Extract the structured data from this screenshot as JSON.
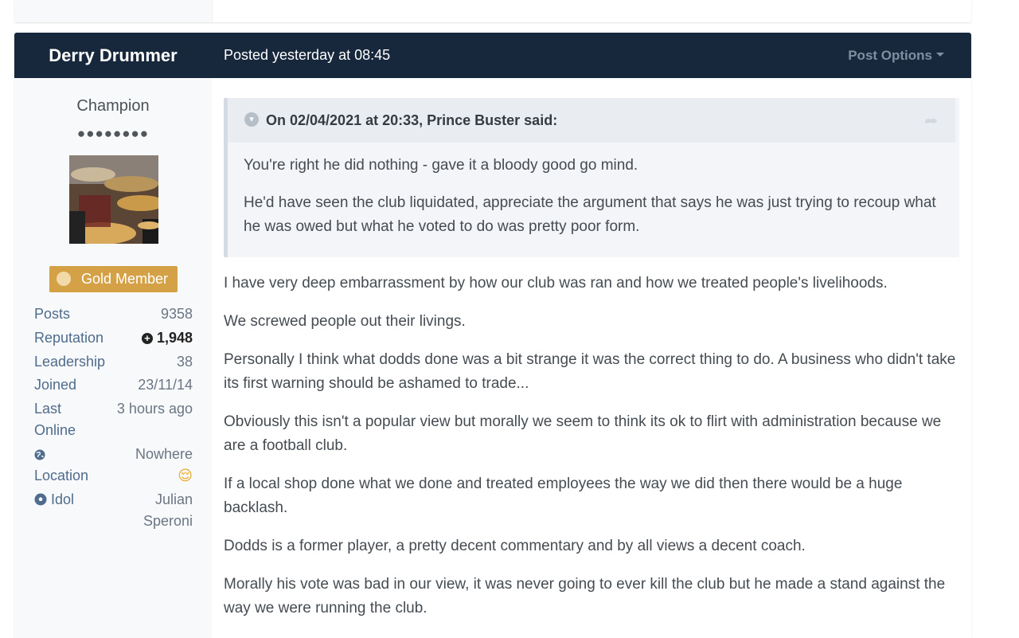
{
  "post": {
    "author": "Derry Drummer",
    "date": "Posted yesterday at 08:45",
    "options_label": "Post Options"
  },
  "author_panel": {
    "rank_title": "Champion",
    "rank_pips": "●●●●●●●●",
    "group_badge": "Gold Member",
    "stats": {
      "posts_label": "Posts",
      "posts_value": "9358",
      "reputation_label": "Reputation",
      "reputation_value": "1,948",
      "leadership_label": "Leadership",
      "leadership_value": "38",
      "joined_label": "Joined",
      "joined_value": "23/11/14",
      "last_online_label_1": "Last",
      "last_online_label_2": "Online",
      "last_online_value": "3 hours ago",
      "location_label": "Location",
      "location_value": "Nowhere",
      "location_emoji": "😌",
      "idol_label": "Idol",
      "idol_value_1": "Julian",
      "idol_value_2": "Speroni"
    }
  },
  "quote": {
    "citation": "On 02/04/2021 at 20:33, Prince Buster said:",
    "paragraphs": [
      "You're right he did nothing - gave it a bloody good go mind.",
      "He'd have seen the club liquidated, appreciate the argument that says he was just trying to recoup what he was owed but what he voted to do was pretty poor form."
    ]
  },
  "body": {
    "paragraphs": [
      "I have very deep embarrassment by how our club was ran and how we treated people's livelihoods.",
      "We screwed people out their livings.",
      "Personally I think what dodds done was a bit strange it was the correct thing to do. A business who didn't take its first warning should be ashamed to trade...",
      "Obviously this isn't a popular view but morally we seem to think its ok to flirt with administration because we are a football club.",
      "If a local shop done what we done and treated employees the way we did then there would be a huge backlash.",
      "Dodds is a former player, a pretty decent commentary and by all views a decent coach.",
      "Morally his vote was bad in our view, it was never going to ever kill the club but he made a stand against the way we were running the club."
    ]
  },
  "colors": {
    "header_bg": "#18283c",
    "badge_gold": "#d4a147",
    "stat_label_blue": "#4f6c8c"
  },
  "icons": [
    "chevron-circle-icon",
    "share-icon",
    "caret-down-icon",
    "globe-icon",
    "soccer-ball-icon",
    "reputation-plus-icon",
    "user-badge-icon"
  ]
}
